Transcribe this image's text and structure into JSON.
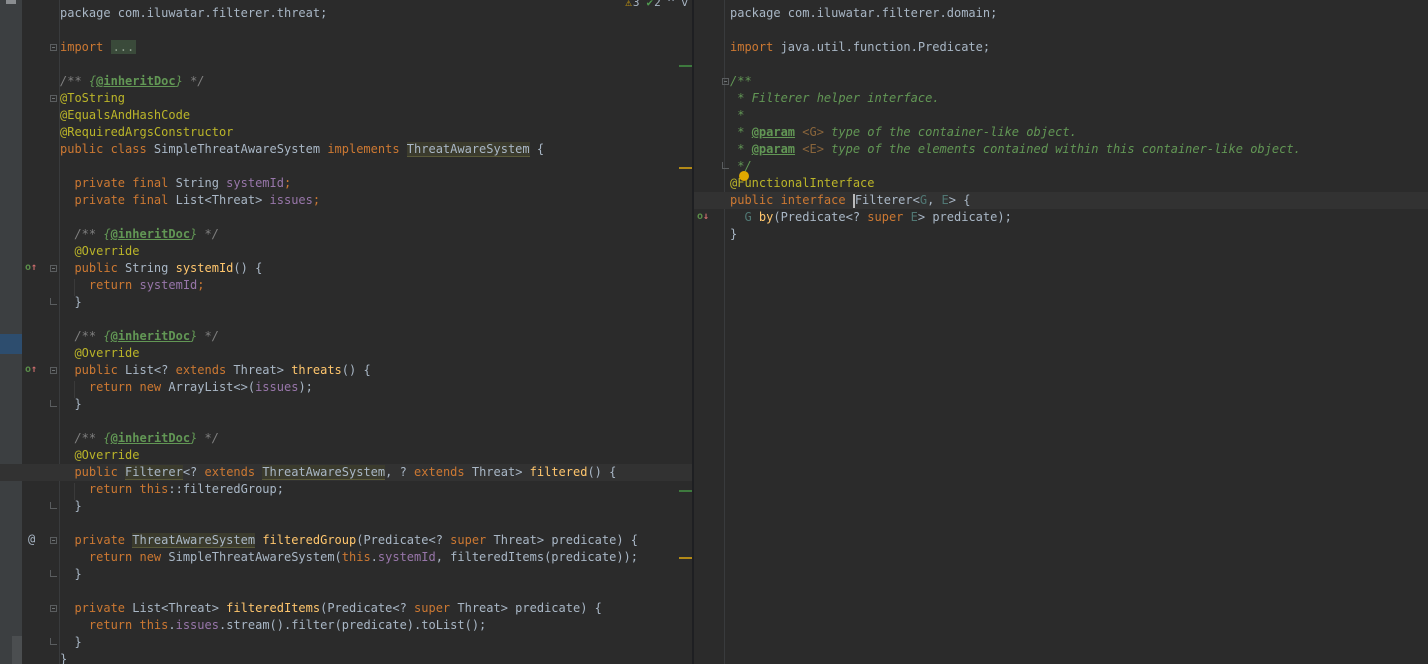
{
  "inspection": {
    "warnings": "3",
    "weak_warnings": "2",
    "up_arrow": "^",
    "down_arrow": "v"
  },
  "left_editor": {
    "lines": [
      [
        {
          "t": "package com.iluwatar.filterer.threat;",
          "c": ""
        }
      ],
      [],
      [
        {
          "t": "import ",
          "c": "kw"
        },
        {
          "t": "...",
          "c": "fold-ph"
        }
      ],
      [],
      [
        {
          "t": "/** ",
          "c": "cm"
        },
        {
          "t": "{",
          "c": "dc"
        },
        {
          "t": "@inheritDoc",
          "c": "dtag"
        },
        {
          "t": "}",
          "c": "dc"
        },
        {
          "t": " */",
          "c": "cm"
        }
      ],
      [
        {
          "t": "@ToString",
          "c": "an"
        }
      ],
      [
        {
          "t": "@EqualsAndHashCode",
          "c": "an"
        }
      ],
      [
        {
          "t": "@RequiredArgsConstructor",
          "c": "an"
        }
      ],
      [
        {
          "t": "public class ",
          "c": "kw"
        },
        {
          "t": "SimpleThreatAwareSystem ",
          "c": ""
        },
        {
          "t": "implements ",
          "c": "kw"
        },
        {
          "t": "ThreatAwareSystem",
          "c": "hlt"
        },
        {
          "t": " {",
          "c": ""
        }
      ],
      [],
      [
        {
          "t": "  private final ",
          "c": "kw"
        },
        {
          "t": "String ",
          "c": ""
        },
        {
          "t": "systemId",
          "c": "fd"
        },
        {
          "t": ";",
          "c": "kw"
        }
      ],
      [
        {
          "t": "  private final ",
          "c": "kw"
        },
        {
          "t": "List<Threat> ",
          "c": ""
        },
        {
          "t": "issues",
          "c": "fd"
        },
        {
          "t": ";",
          "c": "kw"
        }
      ],
      [],
      [
        {
          "t": "  /** ",
          "c": "cm"
        },
        {
          "t": "{",
          "c": "dc"
        },
        {
          "t": "@inheritDoc",
          "c": "dtag"
        },
        {
          "t": "}",
          "c": "dc"
        },
        {
          "t": " */",
          "c": "cm"
        }
      ],
      [
        {
          "t": "  @Override",
          "c": "an"
        }
      ],
      [
        {
          "t": "  public ",
          "c": "kw"
        },
        {
          "t": "String ",
          "c": ""
        },
        {
          "t": "systemId",
          "c": "fn"
        },
        {
          "t": "() {",
          "c": ""
        }
      ],
      [
        {
          "t": "    return ",
          "c": "kw"
        },
        {
          "t": "systemId",
          "c": "fd"
        },
        {
          "t": ";",
          "c": "kw"
        }
      ],
      [
        {
          "t": "  }",
          "c": ""
        }
      ],
      [],
      [
        {
          "t": "  /** ",
          "c": "cm"
        },
        {
          "t": "{",
          "c": "dc"
        },
        {
          "t": "@inheritDoc",
          "c": "dtag"
        },
        {
          "t": "}",
          "c": "dc"
        },
        {
          "t": " */",
          "c": "cm"
        }
      ],
      [
        {
          "t": "  @Override",
          "c": "an"
        }
      ],
      [
        {
          "t": "  public ",
          "c": "kw"
        },
        {
          "t": "List<? ",
          "c": ""
        },
        {
          "t": "extends ",
          "c": "kw"
        },
        {
          "t": "Threat> ",
          "c": ""
        },
        {
          "t": "threats",
          "c": "fn"
        },
        {
          "t": "() {",
          "c": ""
        }
      ],
      [
        {
          "t": "    return new ",
          "c": "kw"
        },
        {
          "t": "ArrayList<>(",
          "c": ""
        },
        {
          "t": "issues",
          "c": "fd"
        },
        {
          "t": ");",
          "c": ""
        }
      ],
      [
        {
          "t": "  }",
          "c": ""
        }
      ],
      [],
      [
        {
          "t": "  /** ",
          "c": "cm"
        },
        {
          "t": "{",
          "c": "dc"
        },
        {
          "t": "@inheritDoc",
          "c": "dtag"
        },
        {
          "t": "}",
          "c": "dc"
        },
        {
          "t": " */",
          "c": "cm"
        }
      ],
      [
        {
          "t": "  @Override",
          "c": "an"
        }
      ],
      [
        {
          "t": "  public ",
          "c": "kw"
        },
        {
          "t": "Filterer",
          "c": "hlt"
        },
        {
          "t": "<? ",
          "c": ""
        },
        {
          "t": "extends ",
          "c": "kw"
        },
        {
          "t": "ThreatAwareSystem",
          "c": "hlt"
        },
        {
          "t": ", ? ",
          "c": ""
        },
        {
          "t": "extends ",
          "c": "kw"
        },
        {
          "t": "Threat> ",
          "c": ""
        },
        {
          "t": "filtered",
          "c": "fn"
        },
        {
          "t": "() {",
          "c": ""
        }
      ],
      [
        {
          "t": "    return this",
          "c": "kw"
        },
        {
          "t": "::filteredGroup;",
          "c": ""
        }
      ],
      [
        {
          "t": "  }",
          "c": ""
        }
      ],
      [],
      [
        {
          "t": "  private ",
          "c": "kw"
        },
        {
          "t": "ThreatAwareSystem",
          "c": "hlt"
        },
        {
          "t": " ",
          "c": ""
        },
        {
          "t": "filteredGroup",
          "c": "fn"
        },
        {
          "t": "(Predicate<? ",
          "c": ""
        },
        {
          "t": "super ",
          "c": "kw"
        },
        {
          "t": "Threat> predicate) {",
          "c": ""
        }
      ],
      [
        {
          "t": "    return new ",
          "c": "kw"
        },
        {
          "t": "SimpleThreatAwareSystem(",
          "c": ""
        },
        {
          "t": "this",
          "c": "kw"
        },
        {
          "t": ".",
          "c": ""
        },
        {
          "t": "systemId",
          "c": "fd"
        },
        {
          "t": ", filteredItems(predicate));",
          "c": ""
        }
      ],
      [
        {
          "t": "  }",
          "c": ""
        }
      ],
      [],
      [
        {
          "t": "  private ",
          "c": "kw"
        },
        {
          "t": "List<Threat> ",
          "c": ""
        },
        {
          "t": "filteredItems",
          "c": "fn"
        },
        {
          "t": "(Predicate<? ",
          "c": ""
        },
        {
          "t": "super ",
          "c": "kw"
        },
        {
          "t": "Threat> predicate) {",
          "c": ""
        }
      ],
      [
        {
          "t": "    return this",
          "c": "kw"
        },
        {
          "t": ".",
          "c": ""
        },
        {
          "t": "issues",
          "c": "fd"
        },
        {
          "t": ".stream().filter(predicate).toList();",
          "c": ""
        }
      ],
      [
        {
          "t": "  }",
          "c": ""
        }
      ],
      [
        {
          "t": "}",
          "c": ""
        }
      ]
    ]
  },
  "right_editor": {
    "lines": [
      [
        {
          "t": "package com.iluwatar.filterer.domain;",
          "c": ""
        }
      ],
      [],
      [
        {
          "t": "import ",
          "c": "kw"
        },
        {
          "t": "java.util.function.Predicate;",
          "c": ""
        }
      ],
      [],
      [
        {
          "t": "/**",
          "c": "dc"
        }
      ],
      [
        {
          "t": " * Filterer helper interface.",
          "c": "dc"
        }
      ],
      [
        {
          "t": " *",
          "c": "dc"
        }
      ],
      [
        {
          "t": " * ",
          "c": "dc"
        },
        {
          "t": "@param",
          "c": "dtag"
        },
        {
          "t": " <G>",
          "c": "dparam"
        },
        {
          "t": " type of the container-like object.",
          "c": "dc"
        }
      ],
      [
        {
          "t": " * ",
          "c": "dc"
        },
        {
          "t": "@param",
          "c": "dtag"
        },
        {
          "t": " <E>",
          "c": "dparam"
        },
        {
          "t": " type of the elements contained within this container-like object.",
          "c": "dc"
        }
      ],
      [
        {
          "t": " */",
          "c": "dc"
        }
      ],
      [
        {
          "t": "@FunctionalInterface",
          "c": "an"
        }
      ],
      [
        {
          "t": "public interface ",
          "c": "kw"
        },
        {
          "t": "|",
          "c": "caret"
        },
        {
          "t": "Filterer<",
          "c": ""
        },
        {
          "t": "G",
          "c": "tp"
        },
        {
          "t": ", ",
          "c": ""
        },
        {
          "t": "E",
          "c": "tp"
        },
        {
          "t": "> {",
          "c": ""
        }
      ],
      [
        {
          "t": "  G ",
          "c": "tp"
        },
        {
          "t": "by",
          "c": "fn"
        },
        {
          "t": "(Predicate<? ",
          "c": ""
        },
        {
          "t": "super ",
          "c": "kw"
        },
        {
          "t": "E",
          "c": "tp"
        },
        {
          "t": "> predicate);",
          "c": ""
        }
      ],
      [
        {
          "t": "}",
          "c": ""
        }
      ]
    ]
  }
}
